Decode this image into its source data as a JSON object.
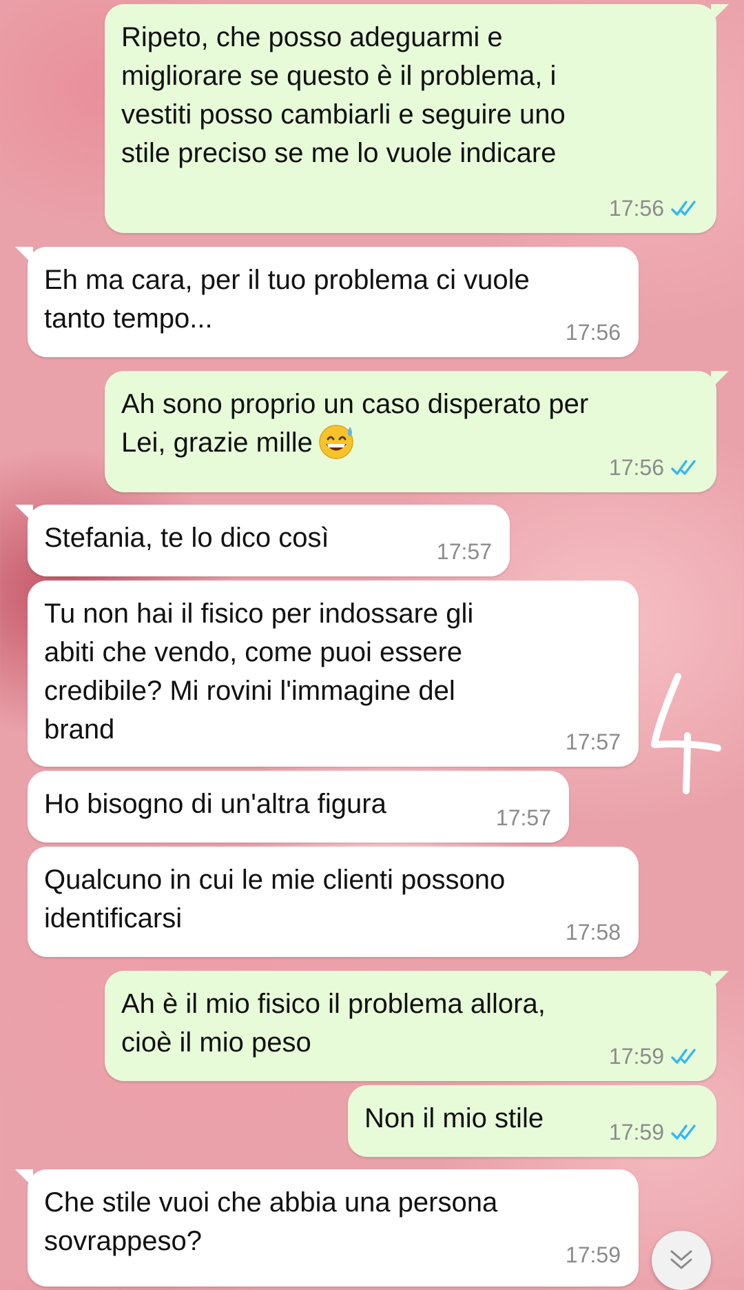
{
  "messages": [
    {
      "dir": "out",
      "text": "Ripeto, che posso adeguarmi e\nmigliorare se questo è il problema, i\nvestiti posso cambiarli e seguire uno\nstile preciso se me lo vuole indicare",
      "time": "17:56",
      "status": "read"
    },
    {
      "dir": "in",
      "text": "Eh ma cara, per il tuo problema ci vuole\ntanto tempo...",
      "time": "17:56"
    },
    {
      "dir": "out",
      "text": "Ah sono proprio un caso disperato per\nLei, grazie mille",
      "time": "17:56",
      "status": "read",
      "emoji": "grinning-face-with-sweat-icon"
    },
    {
      "dir": "in",
      "text": "Stefania, te lo dico così",
      "time": "17:57"
    },
    {
      "dir": "in",
      "text": "Tu non hai il fisico per indossare gli\nabiti che vendo, come puoi essere\ncredibile? Mi rovini l'immagine del\nbrand",
      "time": "17:57"
    },
    {
      "dir": "in",
      "text": "Ho bisogno di un'altra figura",
      "time": "17:57"
    },
    {
      "dir": "in",
      "text": "Qualcuno in cui le mie clienti possono\nidentificarsi",
      "time": "17:58"
    },
    {
      "dir": "out",
      "text": "Ah è il mio fisico il problema allora,\ncioè il mio peso",
      "time": "17:59",
      "status": "read"
    },
    {
      "dir": "out",
      "text": "Non il mio stile",
      "time": "17:59",
      "status": "read"
    },
    {
      "dir": "in",
      "text": "Che stile vuoi che abbia una persona\nsovrappeso?",
      "time": "17:59"
    }
  ],
  "annotation": "4",
  "icons": {
    "read_receipt": "double-check-icon",
    "scroll_down": "double-chevron-down-icon"
  },
  "colors": {
    "incoming": "#ffffff",
    "outgoing": "#e7fbd8",
    "read_check": "#34b7f1",
    "time": "#8b8b8b"
  }
}
